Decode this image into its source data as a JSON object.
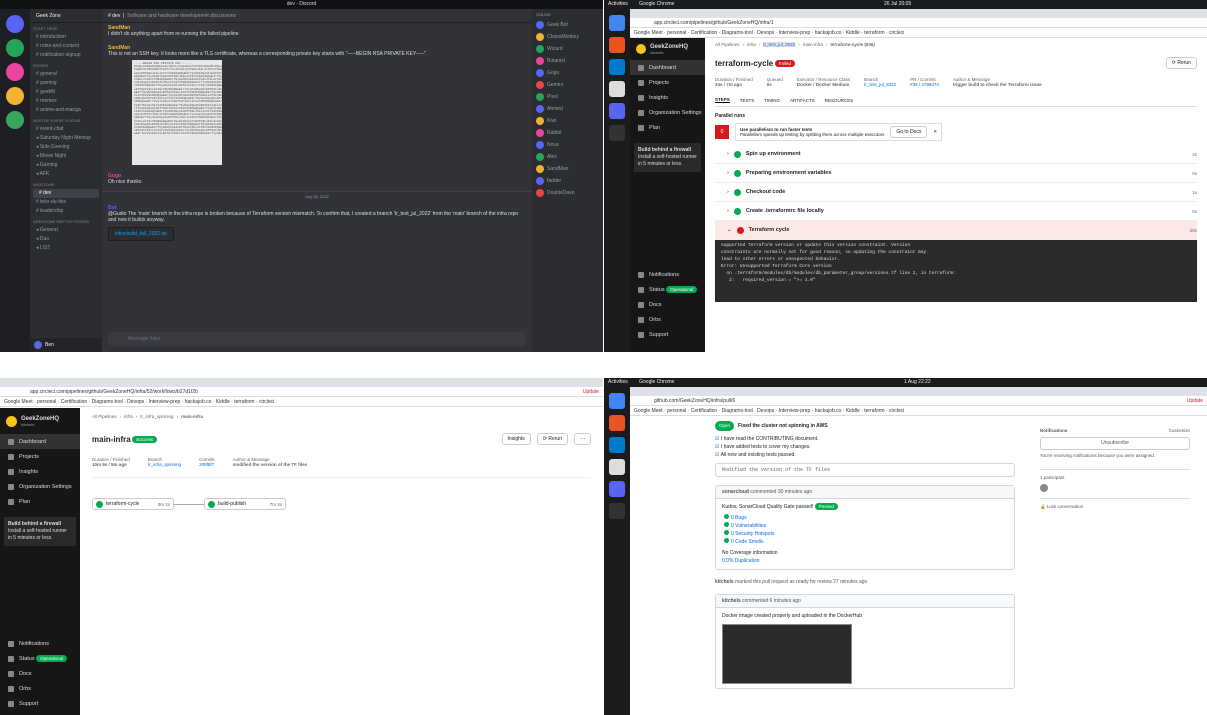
{
  "p1": {
    "window_title": "dev - Discord",
    "server_name": "Geek Zone",
    "channel_name": "dev",
    "channel_topic": "Software and hardware development discussions",
    "categories": [
      "Start Here",
      "Rooms",
      "Meetup Event Rooms",
      "Web Zone",
      "Geekzone Meetup Rooms"
    ],
    "channels": [
      "introduction",
      "roles-and-content",
      "notification-signup",
      "general",
      "gaming",
      "geekfit",
      "memes",
      "anime-and-manga",
      "event-chat",
      "Saturday Night Meetup",
      "Side Evening",
      "Movie Night",
      "Gaming",
      "AFK",
      "dev",
      "teks-du-this",
      "leadership",
      "General",
      "Duo",
      "LIST"
    ],
    "active_channel": "dev",
    "messages": [
      {
        "author": "SandMan",
        "text": "I didn't do anything apart from re-running the failed pipeline"
      },
      {
        "author": "SandMan",
        "text": "This is not an SSH key. It looks more like a TLS certificate, whereas a corresponding private key starts with \"-----BEGIN RSA PRIVATE KEY-----\""
      },
      {
        "author": "",
        "text": "-----BEGIN RSA PRIVATE KEY-----"
      },
      {
        "author": "Gogo",
        "text": "Oh nice thanks"
      },
      {
        "author": "Bot",
        "text": "@Gudio The 'main' branch in the infra repo is broken because of Terraform version mismatch. To confirm that, I created a branch 'tr_test_jul_2022' from the 'main' branch of the infra repo and now it builds anyway."
      },
      {
        "author": "",
        "text": "infra-build_fail_2022.txt"
      }
    ],
    "date_divider": "July 26, 2022",
    "composer_placeholder": "Message #dev",
    "members_header": "ONLINE",
    "members": [
      "Geek Bot",
      "ChaosMonkey",
      "Wizard",
      "Botanist",
      "Gogo",
      "Gemini",
      "Pixel",
      "Ahmed",
      "Kiwi",
      "Rabbit",
      "Nova",
      "Alex",
      "SandMan",
      "fadder",
      "DoubleDave"
    ],
    "user_name": "Ben"
  },
  "p2": {
    "topbar_left": "Activities",
    "topbar_app": "Google Chrome",
    "topbar_time": "26 Jul  20:05",
    "url": "app.circleci.com/pipelines/github/GeekZoneHQ/infra/1",
    "bookmarks": [
      "Google Meet",
      "personal",
      "Certification",
      "Diagrams-tool",
      "Devops",
      "Interview-prep",
      "hackajob.co",
      "Kiddle",
      "terraform",
      "circleci",
      "GIT",
      "AWS-Terraform",
      "File-now",
      "AWS-VPC",
      "jenkins",
      "Other bookmarks"
    ],
    "org": "GeekZoneHQ",
    "org_sub": "kitchels",
    "sidebar": [
      "Dashboard",
      "Projects",
      "Insights",
      "Organization Settings",
      "Plan"
    ],
    "firewall_title": "Build behind a firewall",
    "firewall_text": "Install a self-hosted runner in 5 minutes or less.",
    "bottom": [
      "Notifications",
      "Status",
      "Docs",
      "Orbs",
      "Support"
    ],
    "status_badge": "Operational",
    "crumbs": {
      "dashboard": "Dashboard",
      "project": "Project",
      "branch": "Branch",
      "workflow": "Workflow",
      "job": "Job",
      "all": "All Pipelines",
      "infra": "infra",
      "branch_val": "tr_test_jul_2022",
      "workflow_val": "main-infra",
      "job_val": "terraform-cycle (636)"
    },
    "job_title": "terraform-cycle",
    "job_status": "Failed",
    "rerun": "Rerun",
    "meta": {
      "duration_label": "Duration / Finished",
      "duration": "34s / 7m ago",
      "queued_label": "Queued",
      "queued": "0s",
      "executor_label": "Executor / Resource Class",
      "executor": "Docker / Docker Medium",
      "branch_label": "Branch",
      "branch": "tr_test_jul_2022",
      "pr_label": "PR / Commit",
      "pr": "#38",
      "commit": "4799d74",
      "author_label": "Author & Message",
      "message": "trigger build to check the Terraform issue"
    },
    "tabs": [
      "STEPS",
      "TESTS",
      "TIMING",
      "ARTIFACTS",
      "RESOURCES"
    ],
    "parallel_runs": "Parallel runs",
    "parallel_note_title": "Use parallelism to run faster tests",
    "parallel_note_text": "Parallelism speeds up testing by splitting them across multiple executors",
    "go_docs": "Go to Docs",
    "steps": [
      {
        "name": "Spin up environment",
        "time": "2s",
        "ok": true
      },
      {
        "name": "Preparing environment variables",
        "time": "0s",
        "ok": true
      },
      {
        "name": "Checkout code",
        "time": "1s",
        "ok": true
      },
      {
        "name": "Create .terraformrc file locally",
        "time": "0s",
        "ok": true
      },
      {
        "name": "Terraform cycle",
        "time": "28s",
        "ok": false
      }
    ],
    "terminal": [
      "supported Terraform version or update this version constraint. Version",
      "constraints are normally set for good reason, so updating the constraint may",
      "lead to other errors or unexpected behavior.",
      "",
      "Error: Unsupported Terraform Core version",
      "",
      "  on .terraform/modules/db/modules/db_parameter_group/versions.tf line 2, in terraform:",
      "   2:   required_version = \">= 1.0\""
    ]
  },
  "p3": {
    "url": "app.circleci.com/pipelines/github/GeekZoneHQ/infra/52/workflows/b27d1f2b",
    "update": "Update",
    "crumbs": {
      "dashboard": "Dashboard",
      "project": "Project",
      "branch": "Branch",
      "workflow": "Workflow",
      "all": "All Pipelines",
      "infra": "infra",
      "branch_val": "tr_infra_spinning",
      "workflow_val": "main-infra"
    },
    "title": "main-infra",
    "status": "Success",
    "insights": "Insights",
    "rerun": "Rerun",
    "meta": {
      "duration_label": "Duration / Finished",
      "duration": "10m 9s / 5m ago",
      "branch_label": "Branch",
      "branch": "tr_infra_spinning",
      "commit_label": "Commit",
      "commit": "209f8f7",
      "author_label": "Author & Message",
      "message": "modified the version of the TF files"
    },
    "jobs": [
      {
        "name": "terraform-cycle",
        "time": "3m 2s"
      },
      {
        "name": "build-publish",
        "time": "7m 3s"
      }
    ]
  },
  "p4": {
    "topbar_time": "1 Aug  22:22",
    "url": "github.com/GeekZoneHQ/infra/pull/6",
    "pr_title": "Fixed the cluster not spinning in AWS",
    "pr_state": "Open",
    "checklist": [
      "I have read the CONTRIBUTING document.",
      "I have added tests to cover my changes.",
      "All new and existing tests passed."
    ],
    "review_line": "Modified the version of the TF files",
    "sonar_author": "sonarcloud",
    "sonar_meta": "commented 30 minutes ago",
    "sonar_title": "Kudos, SonarCloud Quality Gate passed!",
    "sonar_badge": "Passed",
    "sonar_items": [
      "0 Bugs",
      "0 Vulnerabilities",
      "0 Security Hotspots",
      "0 Code Smells"
    ],
    "coverage": "No Coverage information",
    "duplication": "0.0% Duplication",
    "ready_event": "marked this pull request as ready for review 27 minutes ago",
    "comment_author": "kitchels",
    "comment_meta": "commented 6 minutes ago",
    "comment_text": "Docker image created properly and uploaded in the DockerHub",
    "sidebar": {
      "notifications": "Notifications",
      "customize": "Customize",
      "unsubscribe": "Unsubscribe",
      "note": "You're receiving notifications because you were assigned.",
      "linked": "1 participant",
      "lock": "Lock conversation"
    },
    "user": "kitchels"
  },
  "colors": {
    "discord_bg": "#313338",
    "circle_side": "#161616",
    "success": "#04aa51",
    "fail": "#d7191c",
    "link": "#0969da"
  }
}
